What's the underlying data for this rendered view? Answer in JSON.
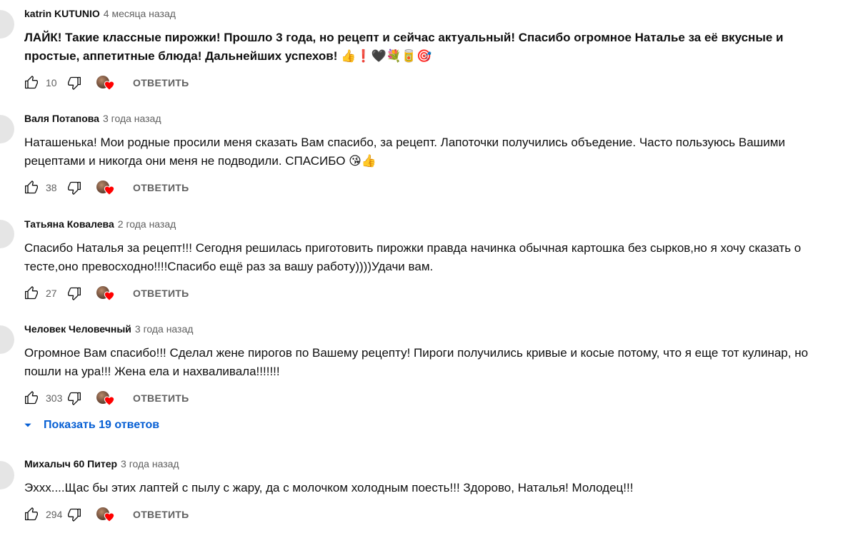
{
  "reply_label": "ОТВЕТИТЬ",
  "show_replies": "Показать 19 ответов",
  "accent_color": "#065fd4",
  "heart_color": "#ff0000",
  "comments": [
    {
      "author": "katrin KUTUNIO",
      "time": "4 месяца назад",
      "text": "ЛАЙК! Такие классные пирожки! Прошло 3 года, но рецепт и сейчас актуальный! Спасибо огромное Наталье за её вкусные и простые, аппетитные блюда! Дальнейших успехов! 👍❗🖤💐🥫🎯",
      "bold": true,
      "likes": "10"
    },
    {
      "author": "Валя Потапова",
      "time": "3 года назад",
      "text": "Наташенька! Мои родные просили меня сказать Вам спасибо, за рецепт. Лапоточки получились объедение. Часто пользуюсь Вашими рецептами и никогда они меня не подводили. СПАСИБО 😘👍",
      "bold": false,
      "likes": "38"
    },
    {
      "author": "Татьяна Ковалева",
      "time": "2 года назад",
      "text": "Спасибо Наталья за рецепт!!! Сегодня решилась приготовить пирожки правда начинка обычная картошка без сырков,но я хочу сказать о тесте,оно превосходно!!!!Спасибо ещё раз за вашу работу))))Удачи вам.",
      "bold": false,
      "likes": "27"
    },
    {
      "author": "Человек Человечный",
      "time": "3 года назад",
      "text": "Огромное Вам спасибо!!! Сделал жене пирогов по Вашему рецепту! Пироги получились кривые и косые потому, что я еще тот кулинар, но пошли на ура!!! Жена ела и нахваливала!!!!!!!",
      "bold": false,
      "likes": "303"
    },
    {
      "author": "Михалыч 60 Питер",
      "time": "3 года назад",
      "text": "Эххх....Щас бы этих лаптей с пылу с жару, да с молочком холодным поесть!!! Здорово, Наталья! Молодец!!!",
      "bold": false,
      "likes": "294"
    }
  ]
}
